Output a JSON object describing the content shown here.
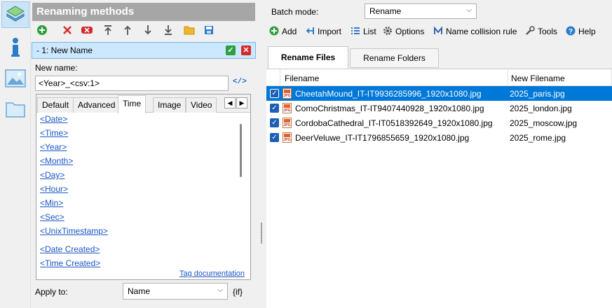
{
  "rail": {
    "items": [
      {
        "icon": "layers-icon",
        "active": true
      },
      {
        "icon": "info-icon",
        "active": false
      },
      {
        "icon": "image-icon",
        "active": false
      },
      {
        "icon": "folder-icon",
        "active": false
      }
    ]
  },
  "left_panel": {
    "title": "Renaming methods",
    "toolbar": [
      "add-icon",
      "delete-icon",
      "clear-icon",
      "move-top-icon",
      "move-up-icon",
      "move-down-icon",
      "move-bottom-icon",
      "open-folder-icon",
      "save-icon"
    ],
    "method": {
      "label": "-  1: New Name"
    },
    "new_name_label": "New name:",
    "new_name_value": "<Year>_<csv:1>",
    "tag_tabs": [
      "Default",
      "Advanced",
      "Time",
      "Image",
      "Video"
    ],
    "active_tab": "Time",
    "tags": [
      "<Date>",
      "<Time>",
      "<Year>",
      "<Month>",
      "<Day>",
      "<Hour>",
      "<Min>",
      "<Sec>",
      "<UnixTimestamp>",
      "<Date Created>",
      "<Time Created>"
    ],
    "tag_doc_link": "Tag documentation",
    "apply_to_label": "Apply to:",
    "apply_to_value": "Name",
    "if_label": "{if}"
  },
  "right_panel": {
    "batch_mode_label": "Batch mode:",
    "batch_mode_value": "Rename",
    "toolbar": [
      {
        "icon": "add-icon",
        "label": "Add"
      },
      {
        "icon": "import-icon",
        "label": "Import"
      },
      {
        "icon": "list-icon",
        "label": "List"
      },
      {
        "icon": "gear-icon",
        "label": "Options"
      },
      {
        "icon": "collision-icon",
        "label": "Name collision rule"
      },
      {
        "icon": "wrench-icon",
        "label": "Tools"
      },
      {
        "icon": "help-icon",
        "label": "Help"
      }
    ],
    "tabs": [
      "Rename Files",
      "Rename Folders"
    ],
    "active_tab": "Rename Files",
    "columns": [
      "Filename",
      "New Filename"
    ],
    "files": [
      {
        "filename": "CheetahMound_IT-IT9936285996_1920x1080.jpg",
        "new_filename": "2025_paris.jpg",
        "checked": true,
        "selected": true
      },
      {
        "filename": "ComoChristmas_IT-IT9407440928_1920x1080.jpg",
        "new_filename": "2025_london.jpg",
        "checked": true,
        "selected": false
      },
      {
        "filename": "CordobaCathedral_IT-IT0518392649_1920x1080.jpg",
        "new_filename": "2025_moscow.jpg",
        "checked": true,
        "selected": false
      },
      {
        "filename": "DeerVeluwe_IT-IT1796855659_1920x1080.jpg",
        "new_filename": "2025_rome.jpg",
        "checked": true,
        "selected": false
      }
    ]
  },
  "colors": {
    "selection": "#0078d7",
    "link": "#1a56c6",
    "panel_title_bg": "#a6a6a6",
    "method_bg": "#cce8ff"
  }
}
